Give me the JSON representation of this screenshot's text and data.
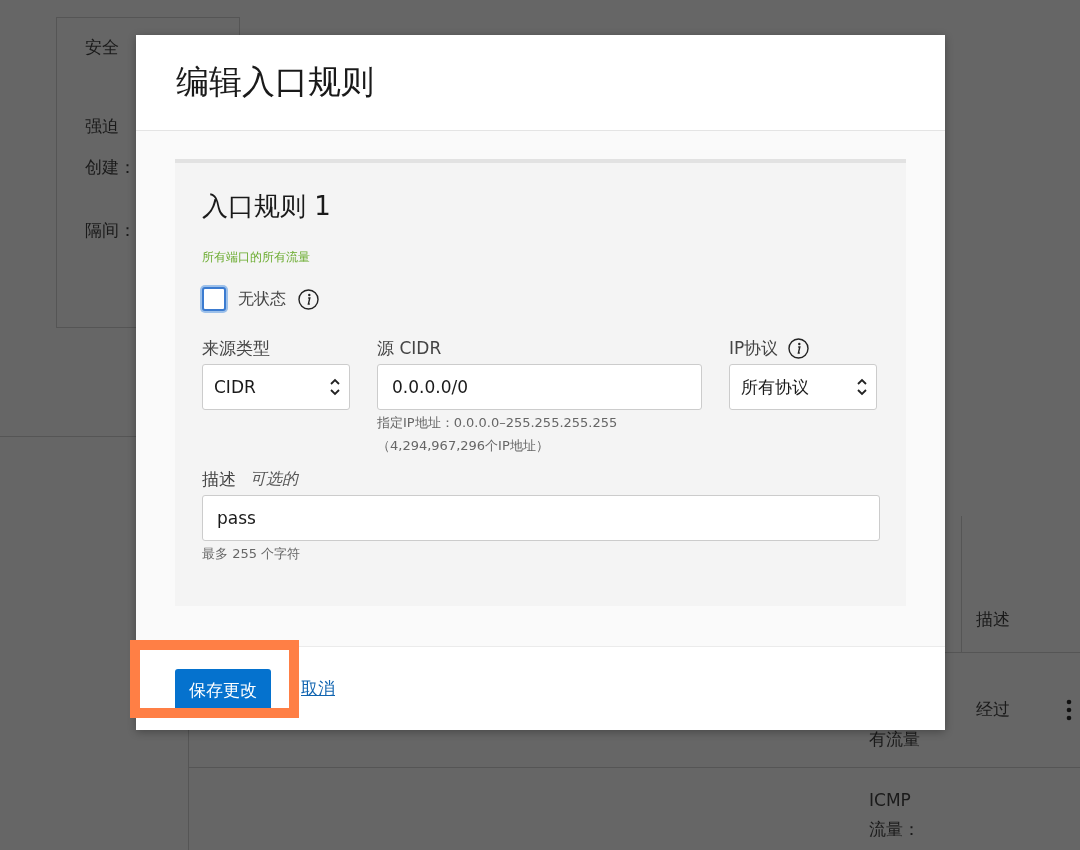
{
  "page": {
    "summary_card": {
      "title": "安全",
      "fields": [
        "强迫",
        "创建：",
        "隔间："
      ]
    },
    "rules_table": {
      "header": "描述",
      "rows": [
        {
          "column_1": [
            "有流量"
          ],
          "description": "经过",
          "actions": true
        },
        {
          "column_1": [
            "ICMP",
            "流量："
          ],
          "description": "",
          "actions": false
        }
      ]
    }
  },
  "dialog": {
    "title": "编辑入口规则",
    "rule": {
      "heading": "入口规则 1",
      "summary": "所有端口的所有流量",
      "stateless": {
        "label": "无状态",
        "checked": false,
        "info": true
      },
      "fields": [
        {
          "kind": "select",
          "label": "来源类型",
          "value": "CIDR",
          "info": false
        },
        {
          "kind": "input",
          "label": "源 CIDR",
          "value": "0.0.0.0/0",
          "info": false,
          "hints": [
            "指定IP地址：0.0.0.0–255.255.255.255",
            "（4,294,967,296个IP地址）"
          ]
        },
        {
          "kind": "select",
          "label": "IP协议",
          "value": "所有协议",
          "info": true
        }
      ],
      "description": {
        "label": "描述",
        "optional": "可选的",
        "value": "pass",
        "hint": "最多 255 个字符"
      }
    },
    "buttons": {
      "primary": "保存更改",
      "cancel": "取消"
    }
  }
}
